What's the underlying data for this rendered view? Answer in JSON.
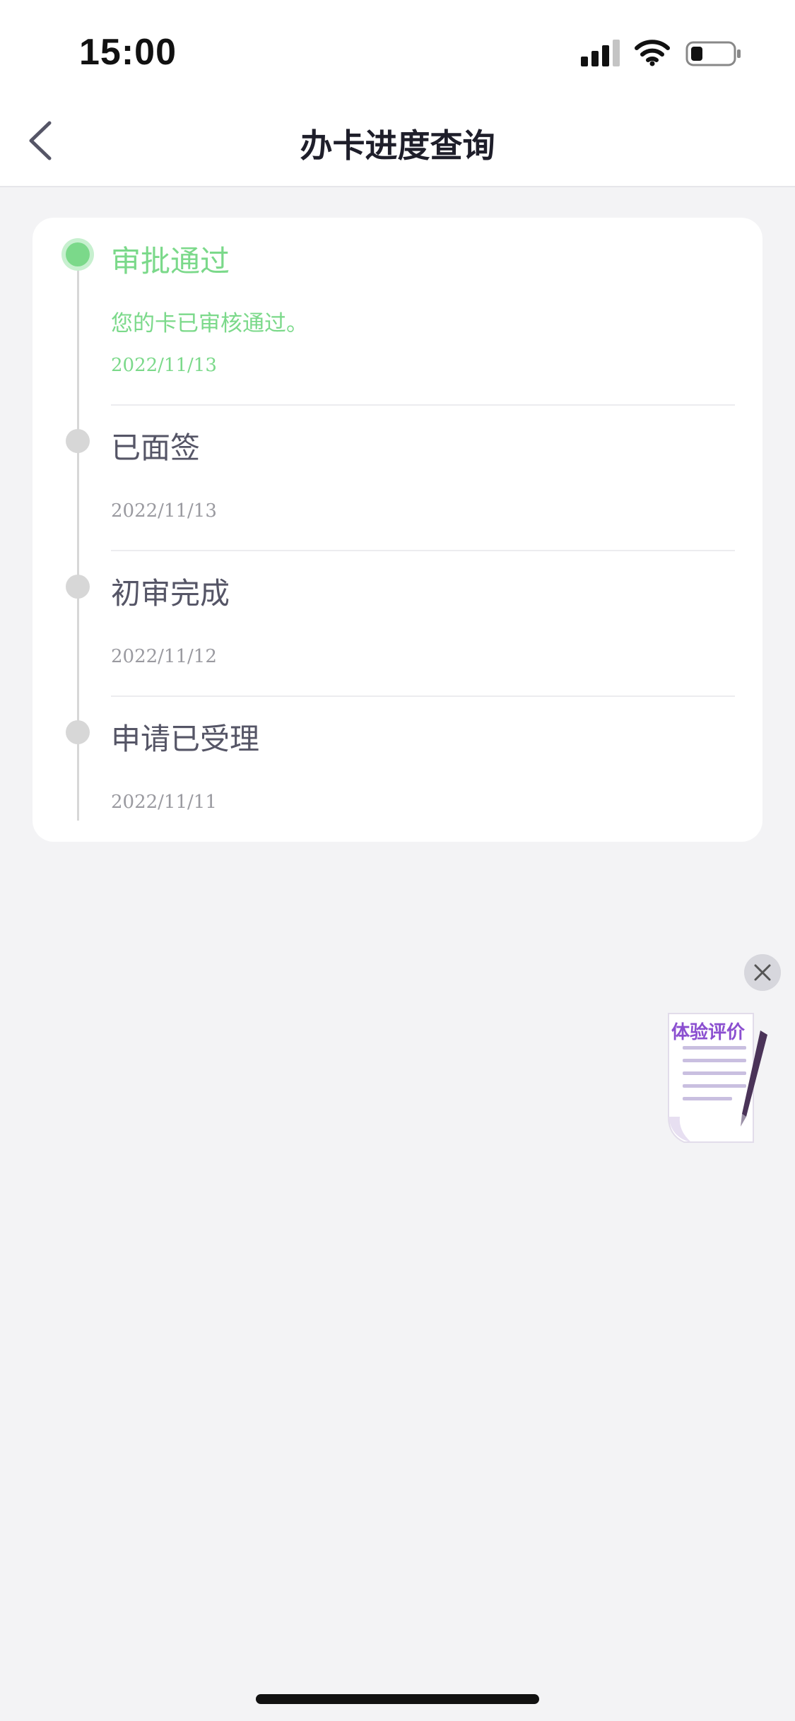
{
  "status_bar": {
    "time": "15:00"
  },
  "nav": {
    "title": "办卡进度查询"
  },
  "steps": [
    {
      "title": "审批通过",
      "desc": "您的卡已审核通过。",
      "date": "2022/11/13",
      "active": true
    },
    {
      "title": "已面签",
      "desc": "",
      "date": "2022/11/13",
      "active": false
    },
    {
      "title": "初审完成",
      "desc": "",
      "date": "2022/11/12",
      "active": false
    },
    {
      "title": "申请已受理",
      "desc": "",
      "date": "2022/11/11",
      "active": false
    }
  ],
  "float_widget": {
    "label": "体验评价"
  },
  "colors": {
    "accent_green": "#7bd98a",
    "inactive_gray": "#d7d7d7",
    "label_purple": "#8b4fd0",
    "background": "#f3f3f5"
  },
  "icons": {
    "back": "chevron-left-icon",
    "close": "close-icon",
    "signal": "cellular-signal-icon",
    "wifi": "wifi-icon",
    "battery": "battery-icon",
    "feedback": "document-pen-icon"
  }
}
